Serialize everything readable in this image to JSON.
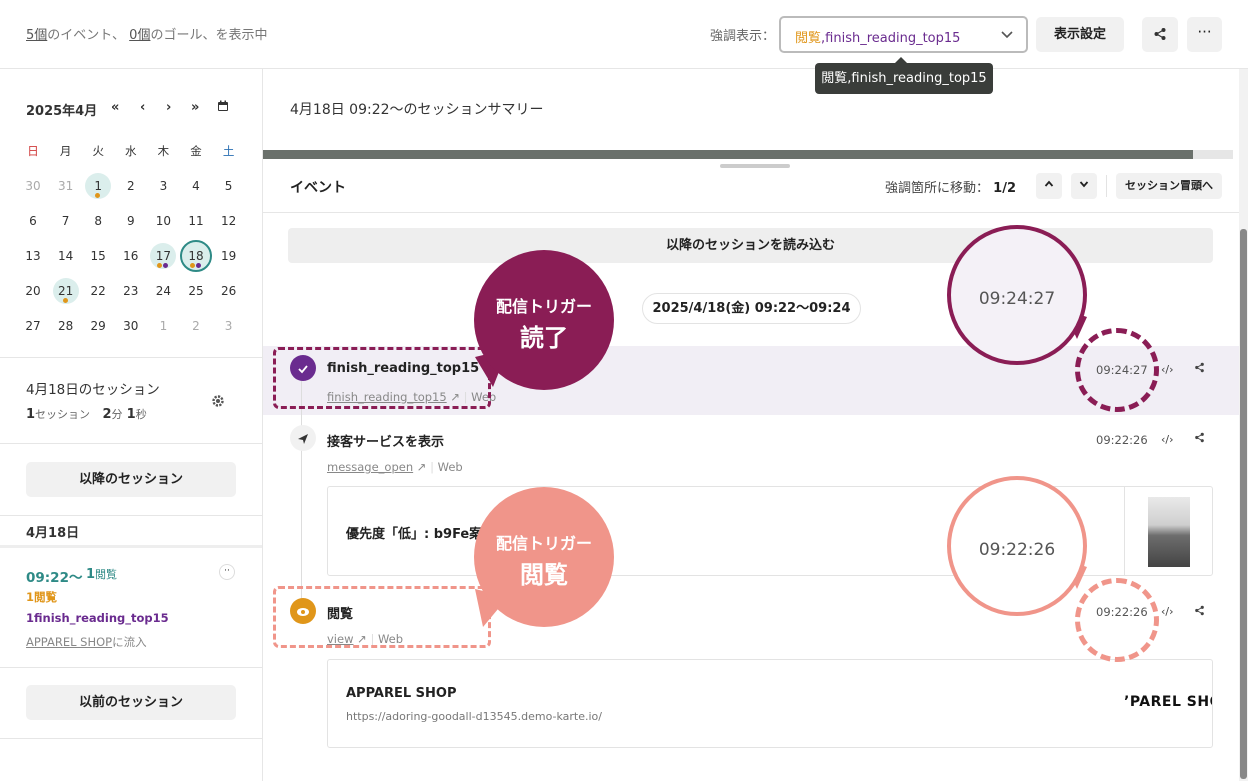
{
  "top": {
    "events_count": "5個",
    "events_suffix": "のイベント、",
    "goals_count": "0個",
    "goals_suffix": "のゴール、を表示中",
    "highlight_label": "強調表示：",
    "highlight_value_1": "閲覧",
    "highlight_value_2": ",finish_reading_top15",
    "view_settings": "表示設定",
    "tooltip": "閲覧,finish_reading_top15"
  },
  "calendar": {
    "title": "2025年4月",
    "nav": [
      "«",
      "‹",
      "›",
      "»"
    ],
    "weekdays": [
      "日",
      "月",
      "火",
      "水",
      "木",
      "金",
      "土"
    ],
    "weeks": [
      [
        "30",
        "31",
        "1",
        "2",
        "3",
        "4",
        "5"
      ],
      [
        "6",
        "7",
        "8",
        "9",
        "10",
        "11",
        "12"
      ],
      [
        "13",
        "14",
        "15",
        "16",
        "17",
        "18",
        "19"
      ],
      [
        "20",
        "21",
        "22",
        "23",
        "24",
        "25",
        "26"
      ],
      [
        "27",
        "28",
        "29",
        "30",
        "1",
        "2",
        "3"
      ]
    ]
  },
  "sidebar": {
    "sessions_title": "4月18日のセッション",
    "session_count": "1",
    "session_unit": "セッション",
    "duration_min": "2",
    "duration_min_unit": "分",
    "duration_sec": "1",
    "duration_sec_unit": "秒",
    "next_sessions": "以降のセッション",
    "date_heading": "4月18日",
    "session_time": "09:22〜",
    "view_count": "1",
    "view_label": "閲覧",
    "goal1_count": "1",
    "goal1_label": "閲覧",
    "goal2_count": "1",
    "goal2_label": "finish_reading_top15",
    "inflow": "APPAREL SHOP",
    "inflow_suffix": "に流入",
    "prev_sessions": "以前のセッション"
  },
  "main": {
    "summary_title": "4月18日 09:22〜のセッションサマリー",
    "events_title": "イベント",
    "jump_label": "強調箇所に移動：",
    "jump_value": "1/2",
    "to_top": "セッション冒頭へ",
    "load_more": "以降のセッションを読み込む",
    "date_range": "2025/4/18(金) 09:22〜09:24"
  },
  "events": [
    {
      "name": "finish_reading_top15",
      "link": "finish_reading_top15",
      "channel": "Web",
      "time": "09:24:27"
    },
    {
      "name": "接客サービスを表示",
      "link": "message_open",
      "channel": "Web",
      "time": "09:22:26",
      "card_text": "優先度「低」: b9Fe案"
    },
    {
      "name": "閲覧",
      "link": "view",
      "channel": "Web",
      "time": "09:22:26",
      "card_title": "APPAREL SHOP",
      "card_url": "https://adoring-goodall-d13545.demo-karte.io/",
      "card_logo": "’PAREL SHO"
    }
  ],
  "overlays": {
    "bubble1_line1": "配信トリガー",
    "bubble1_line2": "読了",
    "bubble2_line1": "配信トリガー",
    "bubble2_line2": "閲覧",
    "mag1": "09:24:27",
    "mag2": "09:22:26"
  },
  "colors": {
    "accent_teal": "#2e8a86",
    "trigger_read": "#8a1d55",
    "trigger_view": "#f0958a",
    "goal_orange": "#e0961a",
    "goal_purple": "#6a2b8f"
  },
  "icons": [
    "share-icon",
    "more-icon",
    "chevron-down-icon",
    "calendar-icon",
    "settings-icon",
    "check-icon",
    "send-icon",
    "eye-icon",
    "external-link-icon",
    "code-icon"
  ]
}
